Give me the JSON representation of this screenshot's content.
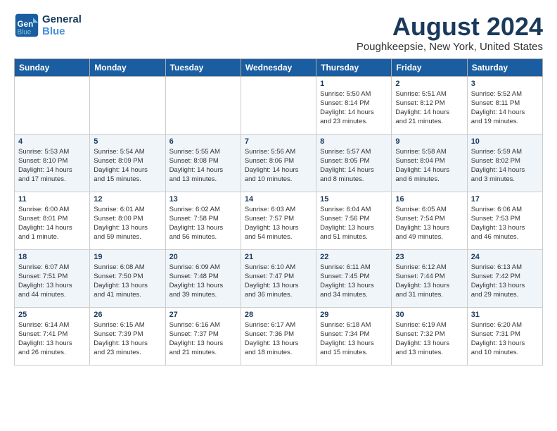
{
  "header": {
    "logo_line1": "General",
    "logo_line2": "Blue",
    "month_title": "August 2024",
    "subtitle": "Poughkeepsie, New York, United States"
  },
  "weekdays": [
    "Sunday",
    "Monday",
    "Tuesday",
    "Wednesday",
    "Thursday",
    "Friday",
    "Saturday"
  ],
  "weeks": [
    [
      {
        "day": "",
        "info": ""
      },
      {
        "day": "",
        "info": ""
      },
      {
        "day": "",
        "info": ""
      },
      {
        "day": "",
        "info": ""
      },
      {
        "day": "1",
        "info": "Sunrise: 5:50 AM\nSunset: 8:14 PM\nDaylight: 14 hours\nand 23 minutes."
      },
      {
        "day": "2",
        "info": "Sunrise: 5:51 AM\nSunset: 8:12 PM\nDaylight: 14 hours\nand 21 minutes."
      },
      {
        "day": "3",
        "info": "Sunrise: 5:52 AM\nSunset: 8:11 PM\nDaylight: 14 hours\nand 19 minutes."
      }
    ],
    [
      {
        "day": "4",
        "info": "Sunrise: 5:53 AM\nSunset: 8:10 PM\nDaylight: 14 hours\nand 17 minutes."
      },
      {
        "day": "5",
        "info": "Sunrise: 5:54 AM\nSunset: 8:09 PM\nDaylight: 14 hours\nand 15 minutes."
      },
      {
        "day": "6",
        "info": "Sunrise: 5:55 AM\nSunset: 8:08 PM\nDaylight: 14 hours\nand 13 minutes."
      },
      {
        "day": "7",
        "info": "Sunrise: 5:56 AM\nSunset: 8:06 PM\nDaylight: 14 hours\nand 10 minutes."
      },
      {
        "day": "8",
        "info": "Sunrise: 5:57 AM\nSunset: 8:05 PM\nDaylight: 14 hours\nand 8 minutes."
      },
      {
        "day": "9",
        "info": "Sunrise: 5:58 AM\nSunset: 8:04 PM\nDaylight: 14 hours\nand 6 minutes."
      },
      {
        "day": "10",
        "info": "Sunrise: 5:59 AM\nSunset: 8:02 PM\nDaylight: 14 hours\nand 3 minutes."
      }
    ],
    [
      {
        "day": "11",
        "info": "Sunrise: 6:00 AM\nSunset: 8:01 PM\nDaylight: 14 hours\nand 1 minute."
      },
      {
        "day": "12",
        "info": "Sunrise: 6:01 AM\nSunset: 8:00 PM\nDaylight: 13 hours\nand 59 minutes."
      },
      {
        "day": "13",
        "info": "Sunrise: 6:02 AM\nSunset: 7:58 PM\nDaylight: 13 hours\nand 56 minutes."
      },
      {
        "day": "14",
        "info": "Sunrise: 6:03 AM\nSunset: 7:57 PM\nDaylight: 13 hours\nand 54 minutes."
      },
      {
        "day": "15",
        "info": "Sunrise: 6:04 AM\nSunset: 7:56 PM\nDaylight: 13 hours\nand 51 minutes."
      },
      {
        "day": "16",
        "info": "Sunrise: 6:05 AM\nSunset: 7:54 PM\nDaylight: 13 hours\nand 49 minutes."
      },
      {
        "day": "17",
        "info": "Sunrise: 6:06 AM\nSunset: 7:53 PM\nDaylight: 13 hours\nand 46 minutes."
      }
    ],
    [
      {
        "day": "18",
        "info": "Sunrise: 6:07 AM\nSunset: 7:51 PM\nDaylight: 13 hours\nand 44 minutes."
      },
      {
        "day": "19",
        "info": "Sunrise: 6:08 AM\nSunset: 7:50 PM\nDaylight: 13 hours\nand 41 minutes."
      },
      {
        "day": "20",
        "info": "Sunrise: 6:09 AM\nSunset: 7:48 PM\nDaylight: 13 hours\nand 39 minutes."
      },
      {
        "day": "21",
        "info": "Sunrise: 6:10 AM\nSunset: 7:47 PM\nDaylight: 13 hours\nand 36 minutes."
      },
      {
        "day": "22",
        "info": "Sunrise: 6:11 AM\nSunset: 7:45 PM\nDaylight: 13 hours\nand 34 minutes."
      },
      {
        "day": "23",
        "info": "Sunrise: 6:12 AM\nSunset: 7:44 PM\nDaylight: 13 hours\nand 31 minutes."
      },
      {
        "day": "24",
        "info": "Sunrise: 6:13 AM\nSunset: 7:42 PM\nDaylight: 13 hours\nand 29 minutes."
      }
    ],
    [
      {
        "day": "25",
        "info": "Sunrise: 6:14 AM\nSunset: 7:41 PM\nDaylight: 13 hours\nand 26 minutes."
      },
      {
        "day": "26",
        "info": "Sunrise: 6:15 AM\nSunset: 7:39 PM\nDaylight: 13 hours\nand 23 minutes."
      },
      {
        "day": "27",
        "info": "Sunrise: 6:16 AM\nSunset: 7:37 PM\nDaylight: 13 hours\nand 21 minutes."
      },
      {
        "day": "28",
        "info": "Sunrise: 6:17 AM\nSunset: 7:36 PM\nDaylight: 13 hours\nand 18 minutes."
      },
      {
        "day": "29",
        "info": "Sunrise: 6:18 AM\nSunset: 7:34 PM\nDaylight: 13 hours\nand 15 minutes."
      },
      {
        "day": "30",
        "info": "Sunrise: 6:19 AM\nSunset: 7:32 PM\nDaylight: 13 hours\nand 13 minutes."
      },
      {
        "day": "31",
        "info": "Sunrise: 6:20 AM\nSunset: 7:31 PM\nDaylight: 13 hours\nand 10 minutes."
      }
    ]
  ]
}
